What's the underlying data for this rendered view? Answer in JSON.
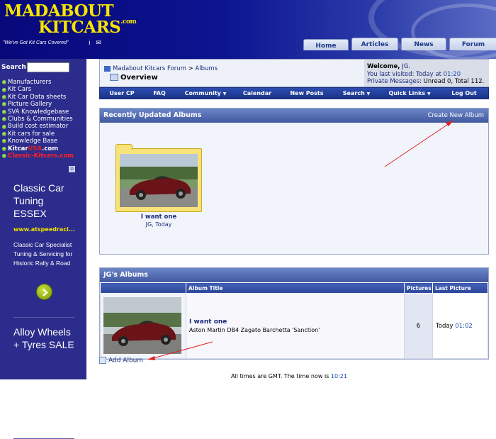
{
  "header": {
    "logo_line1": "MADABOUT",
    "logo_line2": "KITCARS",
    "logo_com": ".com",
    "slogan": "\"We've Got Kit Cars Covered\"",
    "info_icon": "i",
    "mail_icon": "✉",
    "tabs": [
      "Home",
      "Articles",
      "News",
      "Forum"
    ]
  },
  "sidebar": {
    "search_label": "Search",
    "nav": [
      "Manufacturers",
      "Kit Cars",
      "Kit Car Data sheets",
      "Picture Gallery",
      "SVA Knowledgebase",
      "Clubs & Communities",
      "Build cost estimator",
      "Kit cars for sale",
      "Knowledge Base"
    ],
    "kitcarusa_a": "Kitcar",
    "kitcarusa_b": "USA",
    "kitcarusa_c": ".com",
    "classic": "Classic-Kitcars.com",
    "ad_marker": "D",
    "ad1": {
      "title": "Classic Car Tuning ESSEX",
      "url": "www.atspeedraci...",
      "text": "Classic Car Specialist Tuning & Servicing for Historic Rally & Road"
    },
    "ad2": {
      "title": "Alloy Wheels + Tyres SALE",
      "chev": "⌄"
    }
  },
  "breadcrumb": {
    "forum": "Madabout Kitcars Forum",
    "sep": ">",
    "albums": "Albums",
    "page_title": "Overview"
  },
  "welcome": {
    "label": "Welcome,",
    "user": "JG.",
    "visited_label": "You last visited: Today at",
    "visited_time": "01:20",
    "pm_label": "Private Messages",
    "pm_text": ": Unread 0, Total 112."
  },
  "navbar": [
    {
      "label": "User CP",
      "caret": false
    },
    {
      "label": "FAQ",
      "caret": false
    },
    {
      "label": "Community",
      "caret": true
    },
    {
      "label": "Calendar",
      "caret": false
    },
    {
      "label": "New Posts",
      "caret": false
    },
    {
      "label": "Search",
      "caret": true
    },
    {
      "label": "Quick Links",
      "caret": true
    },
    {
      "label": "Log Out",
      "caret": false
    }
  ],
  "recent": {
    "heading": "Recently Updated Albums",
    "create_link": "Create New Album",
    "album_name": "I want one",
    "album_meta": "JG, Today"
  },
  "my_albums": {
    "heading": "JG's Albums",
    "columns": [
      "",
      "Album Title",
      "Pictures",
      "Last Picture"
    ],
    "row": {
      "title": "I want one",
      "description": "Aston Martin DB4 Zagato Barchetta 'Sanction'",
      "pictures": "6",
      "last_day": "Today",
      "last_time": "01:02"
    },
    "add_album": "Add Album"
  },
  "footer": {
    "text": "All times are GMT. The time now is",
    "time": "10:21"
  },
  "colors": {
    "header_bg": "#08087a",
    "sidebar_bg": "#2c2c8c",
    "logo_yellow": "#f5e400",
    "link_blue": "#1c2c7a",
    "annotation_red": "#e02020"
  }
}
